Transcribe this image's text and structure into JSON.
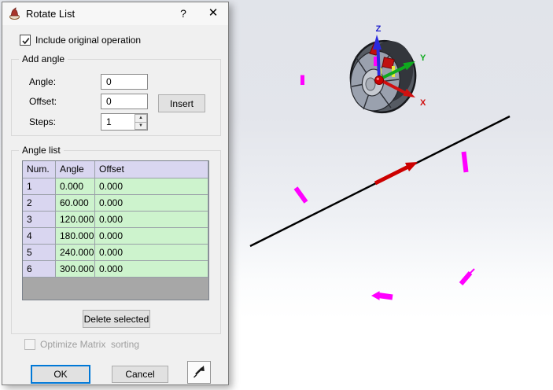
{
  "window": {
    "title": "Rotate List",
    "help_button": "?",
    "close_button": "✕"
  },
  "options": {
    "include_original_label": "Include original operation",
    "include_original_checked": true,
    "optimize_label": "Optimize Matrix  sorting",
    "optimize_checked": false
  },
  "add_angle": {
    "group_label": "Add angle",
    "angle_label": "Angle:",
    "angle_value": "0",
    "offset_label": "Offset:",
    "offset_value": "0",
    "steps_label": "Steps:",
    "steps_value": "1",
    "insert_button": "Insert"
  },
  "angle_list": {
    "group_label": "Angle list",
    "headers": {
      "num": "Num.",
      "angle": "Angle",
      "offset": "Offset"
    },
    "rows": [
      {
        "num": "1",
        "angle": "0.000",
        "offset": "0.000"
      },
      {
        "num": "2",
        "angle": "60.000",
        "offset": "0.000"
      },
      {
        "num": "3",
        "angle": "120.000",
        "offset": "0.000"
      },
      {
        "num": "4",
        "angle": "180.000",
        "offset": "0.000"
      },
      {
        "num": "5",
        "angle": "240.000",
        "offset": "0.000"
      },
      {
        "num": "6",
        "angle": "300.000",
        "offset": "0.000"
      }
    ],
    "delete_button": "Delete selected"
  },
  "actions": {
    "ok_button": "OK",
    "cancel_button": "Cancel"
  },
  "viewport": {
    "triad": {
      "x_label": "X",
      "y_label": "Y",
      "z_label": "Z"
    },
    "colors": {
      "x_axis": "#d01010",
      "y_axis": "#0faa1e",
      "z_axis": "#2a2ae0",
      "highlight": "#ff00ff",
      "sketch_line": "#000000",
      "background_top": "#e1e4ea",
      "background_bottom": "#ffffff"
    }
  }
}
